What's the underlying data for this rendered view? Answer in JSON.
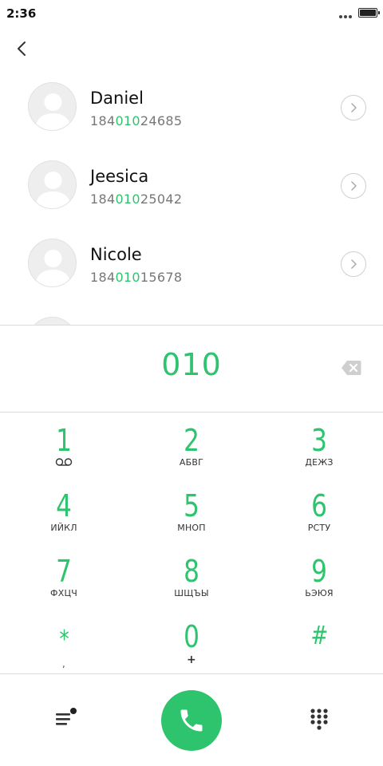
{
  "status_bar": {
    "time": "2:36",
    "icons": [
      "more-dots-icon",
      "battery-icon"
    ]
  },
  "nav": {
    "back_icon": "chevron-left-icon"
  },
  "contacts": [
    {
      "name": "Daniel",
      "number_prefix": "184",
      "number_match": "010",
      "number_suffix": "24685"
    },
    {
      "name": "Jeesica",
      "number_prefix": "184",
      "number_match": "010",
      "number_suffix": "25042"
    },
    {
      "name": "Nicole",
      "number_prefix": "184",
      "number_match": "010",
      "number_suffix": "15678"
    }
  ],
  "dialer": {
    "dialed_number": "010",
    "backspace_icon": "backspace-icon"
  },
  "keypad": [
    {
      "digit": "1",
      "letters": ""
    },
    {
      "digit": "2",
      "letters": "АБВГ"
    },
    {
      "digit": "3",
      "letters": "ДЕЖЗ"
    },
    {
      "digit": "4",
      "letters": "ИЙКЛ"
    },
    {
      "digit": "5",
      "letters": "МНОП"
    },
    {
      "digit": "6",
      "letters": "РСТУ"
    },
    {
      "digit": "7",
      "letters": "ФХЦЧ"
    },
    {
      "digit": "8",
      "letters": "ШЩЪЫ"
    },
    {
      "digit": "9",
      "letters": "ЬЭЮЯ"
    },
    {
      "digit": "*",
      "letters": ","
    },
    {
      "digit": "0",
      "letters": "+"
    },
    {
      "digit": "#",
      "letters": ""
    }
  ],
  "bottom_bar": {
    "menu_icon": "menu-icon",
    "call_icon": "phone-icon",
    "keypad_icon": "dialpad-icon"
  },
  "colors": {
    "accent": "#2ec46e",
    "text": "#111111",
    "secondary_text": "#777777",
    "divider": "#dcdcdc"
  }
}
